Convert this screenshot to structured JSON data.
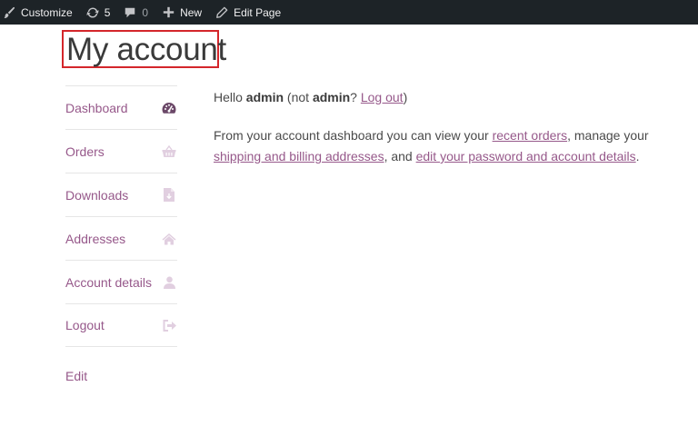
{
  "adminbar": {
    "customize": "Customize",
    "updates_count": "5",
    "comments_count": "0",
    "new_label": "New",
    "edit_page": "Edit Page"
  },
  "page": {
    "title": "My account"
  },
  "nav": {
    "items": [
      {
        "label": "Dashboard",
        "icon": "dashboard-icon",
        "active": true
      },
      {
        "label": "Orders",
        "icon": "basket-icon"
      },
      {
        "label": "Downloads",
        "icon": "file-icon"
      },
      {
        "label": "Addresses",
        "icon": "home-icon"
      },
      {
        "label": "Account details",
        "icon": "user-icon"
      },
      {
        "label": "Logout",
        "icon": "sign-out-icon"
      }
    ],
    "edit": "Edit"
  },
  "content": {
    "hello": "Hello",
    "user": "admin",
    "not_open": "(not",
    "not_user": "admin",
    "qmark": "?",
    "logout_link": "Log out",
    "close_paren": ")",
    "dash_text_1": "From your account dashboard you can view your",
    "recent_orders": "recent orders",
    "dash_text_2": ", manage your",
    "addresses_link": "shipping and billing addresses",
    "dash_text_3": ", and",
    "password_link": "edit your password and account details",
    "dash_text_4": "."
  },
  "colors": {
    "accent": "#96588a",
    "adminbar_bg": "#1d2327",
    "title_border": "#d4262b"
  }
}
